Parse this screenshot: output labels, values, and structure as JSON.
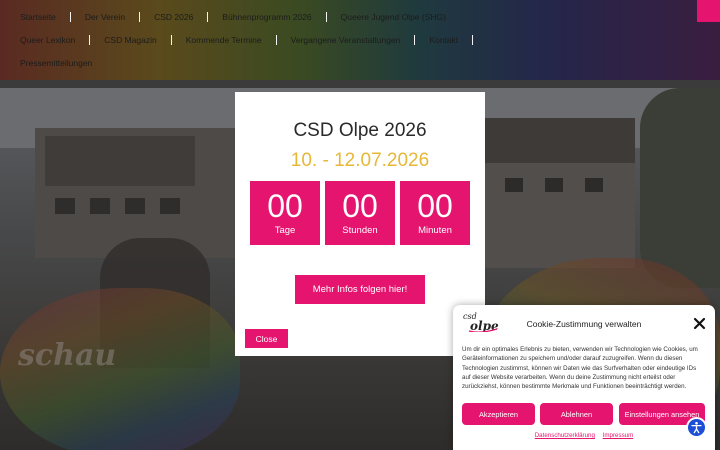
{
  "nav": {
    "row1": [
      "Startseite",
      "Der Verein",
      "CSD 2026",
      "Bühnenprogramm 2026",
      "Queere Jugend Olpe (SHG)"
    ],
    "row2": [
      "Queer Lexikon",
      "CSD Magazin",
      "Kommende Termine",
      "Vergangene Veranstaltungen",
      "Kontakt"
    ],
    "row3": [
      "Pressemitteilungen"
    ]
  },
  "hero": {
    "script_text": "schau"
  },
  "popup": {
    "title": "CSD Olpe 2026",
    "date": "10. - 12.07.2026",
    "countdown": [
      {
        "value": "00",
        "label": "Tage"
      },
      {
        "value": "00",
        "label": "Stunden"
      },
      {
        "value": "00",
        "label": "Minuten"
      }
    ],
    "more_button": "Mehr Infos folgen hier!",
    "close_button": "Close"
  },
  "cookie": {
    "logo_text": "csd olpe",
    "title": "Cookie-Zustimmung verwalten",
    "text": "Um dir ein optimales Erlebnis zu bieten, verwenden wir Technologien wie Cookies, um Geräteinformationen zu speichern und/oder darauf zuzugreifen. Wenn du diesen Technologien zustimmst, können wir Daten wie das Surfverhalten oder eindeutige IDs auf dieser Website verarbeiten. Wenn du deine Zustimmung nicht erteilst oder zurückziehst, können bestimmte Merkmale und Funktionen beeinträchtigt werden.",
    "accept": "Akzeptieren",
    "decline": "Ablehnen",
    "settings": "Einstellungen ansehen",
    "link_privacy": "Datenschutzerklärung",
    "link_imprint": "Impressum"
  },
  "colors": {
    "accent": "#e5146f",
    "date": "#e7b736",
    "a11y": "#1c4fd6"
  },
  "icons": {
    "close": "close-icon",
    "accessibility": "accessibility-icon"
  }
}
